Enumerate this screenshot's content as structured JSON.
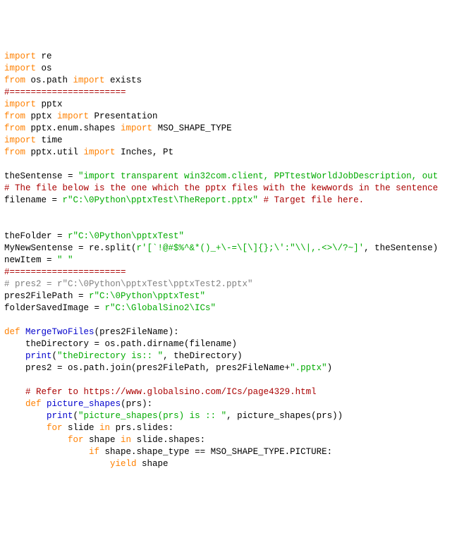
{
  "lines": [
    [
      {
        "cls": "kw",
        "t": "import"
      },
      {
        "cls": "txt",
        "t": " re"
      }
    ],
    [
      {
        "cls": "kw",
        "t": "import"
      },
      {
        "cls": "txt",
        "t": " os"
      }
    ],
    [
      {
        "cls": "kw",
        "t": "from"
      },
      {
        "cls": "txt",
        "t": " os.path "
      },
      {
        "cls": "kw",
        "t": "import"
      },
      {
        "cls": "txt",
        "t": " exists"
      }
    ],
    [
      {
        "cls": "cmt-red",
        "t": "#======================"
      }
    ],
    [
      {
        "cls": "kw",
        "t": "import"
      },
      {
        "cls": "txt",
        "t": " pptx"
      }
    ],
    [
      {
        "cls": "kw",
        "t": "from"
      },
      {
        "cls": "txt",
        "t": " pptx "
      },
      {
        "cls": "kw",
        "t": "import"
      },
      {
        "cls": "txt",
        "t": " Presentation"
      }
    ],
    [
      {
        "cls": "kw",
        "t": "from"
      },
      {
        "cls": "txt",
        "t": " pptx.enum.shapes "
      },
      {
        "cls": "kw",
        "t": "import"
      },
      {
        "cls": "txt",
        "t": " MSO_SHAPE_TYPE"
      }
    ],
    [
      {
        "cls": "kw",
        "t": "import"
      },
      {
        "cls": "txt",
        "t": " time"
      }
    ],
    [
      {
        "cls": "kw",
        "t": "from"
      },
      {
        "cls": "txt",
        "t": " pptx.util "
      },
      {
        "cls": "kw",
        "t": "import"
      },
      {
        "cls": "txt",
        "t": " Inches, Pt"
      }
    ],
    [
      {
        "cls": "txt",
        "t": " "
      }
    ],
    [
      {
        "cls": "txt",
        "t": "theSentense = "
      },
      {
        "cls": "str",
        "t": "\"import transparent win32com.client, PPTtestWorldJobDescription, out"
      }
    ],
    [
      {
        "cls": "cmt-red",
        "t": "# The file below is the one which the pptx files with the kewwords in the sentence"
      }
    ],
    [
      {
        "cls": "txt",
        "t": "filename = "
      },
      {
        "cls": "str",
        "t": "r\"C:\\0Python\\pptxTest\\TheReport.pptx\""
      },
      {
        "cls": "txt",
        "t": " "
      },
      {
        "cls": "cmt-red",
        "t": "# Target file here."
      }
    ],
    [
      {
        "cls": "txt",
        "t": " "
      }
    ],
    [
      {
        "cls": "txt",
        "t": " "
      }
    ],
    [
      {
        "cls": "txt",
        "t": "theFolder = "
      },
      {
        "cls": "str",
        "t": "r\"C:\\0Python\\pptxTest\""
      }
    ],
    [
      {
        "cls": "txt",
        "t": "MyNewSentense = re.split("
      },
      {
        "cls": "str",
        "t": "r'[`!@#$%^&*()_+\\-=\\[\\]{};\\':\"\\\\|,.<>\\/?~]'"
      },
      {
        "cls": "txt",
        "t": ", theSentense)"
      }
    ],
    [
      {
        "cls": "txt",
        "t": "newItem = "
      },
      {
        "cls": "str",
        "t": "\" \""
      }
    ],
    [
      {
        "cls": "cmt-red",
        "t": "#======================"
      }
    ],
    [
      {
        "cls": "cmt-gray",
        "t": "# pres2 = r\"C:\\0Python\\pptxTest\\pptxTest2.pptx\""
      }
    ],
    [
      {
        "cls": "txt",
        "t": "pres2FilePath = "
      },
      {
        "cls": "str",
        "t": "r\"C:\\0Python\\pptxTest\""
      }
    ],
    [
      {
        "cls": "txt",
        "t": "folderSavedImage = "
      },
      {
        "cls": "str",
        "t": "r\"C:\\GlobalSino2\\ICs\""
      }
    ],
    [
      {
        "cls": "txt",
        "t": " "
      }
    ],
    [
      {
        "cls": "kw",
        "t": "def"
      },
      {
        "cls": "txt",
        "t": " "
      },
      {
        "cls": "fn",
        "t": "MergeTwoFiles"
      },
      {
        "cls": "txt",
        "t": "(pres2FileName):"
      }
    ],
    [
      {
        "cls": "txt",
        "t": "    theDirectory = os.path.dirname(filename)"
      }
    ],
    [
      {
        "cls": "txt",
        "t": "    "
      },
      {
        "cls": "fn",
        "t": "print"
      },
      {
        "cls": "txt",
        "t": "("
      },
      {
        "cls": "str",
        "t": "\"theDirectory is:: \""
      },
      {
        "cls": "txt",
        "t": ", theDirectory)"
      }
    ],
    [
      {
        "cls": "txt",
        "t": "    pres2 = os.path.join(pres2FilePath, pres2FileName+"
      },
      {
        "cls": "str",
        "t": "\".pptx\""
      },
      {
        "cls": "txt",
        "t": ")"
      }
    ],
    [
      {
        "cls": "txt",
        "t": " "
      }
    ],
    [
      {
        "cls": "txt",
        "t": "    "
      },
      {
        "cls": "cmt-red",
        "t": "# Refer to https://www.globalsino.com/ICs/page4329.html"
      }
    ],
    [
      {
        "cls": "txt",
        "t": "    "
      },
      {
        "cls": "kw",
        "t": "def"
      },
      {
        "cls": "txt",
        "t": " "
      },
      {
        "cls": "fn",
        "t": "picture_shapes"
      },
      {
        "cls": "txt",
        "t": "(prs):"
      }
    ],
    [
      {
        "cls": "txt",
        "t": "        "
      },
      {
        "cls": "fn",
        "t": "print"
      },
      {
        "cls": "txt",
        "t": "("
      },
      {
        "cls": "str",
        "t": "\"picture_shapes(prs) is :: \""
      },
      {
        "cls": "txt",
        "t": ", picture_shapes(prs))"
      }
    ],
    [
      {
        "cls": "txt",
        "t": "        "
      },
      {
        "cls": "kw",
        "t": "for"
      },
      {
        "cls": "txt",
        "t": " slide "
      },
      {
        "cls": "kw",
        "t": "in"
      },
      {
        "cls": "txt",
        "t": " prs.slides:"
      }
    ],
    [
      {
        "cls": "txt",
        "t": "            "
      },
      {
        "cls": "kw",
        "t": "for"
      },
      {
        "cls": "txt",
        "t": " shape "
      },
      {
        "cls": "kw",
        "t": "in"
      },
      {
        "cls": "txt",
        "t": " slide.shapes:"
      }
    ],
    [
      {
        "cls": "txt",
        "t": "                "
      },
      {
        "cls": "kw",
        "t": "if"
      },
      {
        "cls": "txt",
        "t": " shape.shape_type == MSO_SHAPE_TYPE.PICTURE:"
      }
    ],
    [
      {
        "cls": "txt",
        "t": "                    "
      },
      {
        "cls": "kw",
        "t": "yield"
      },
      {
        "cls": "txt",
        "t": " shape"
      }
    ]
  ]
}
